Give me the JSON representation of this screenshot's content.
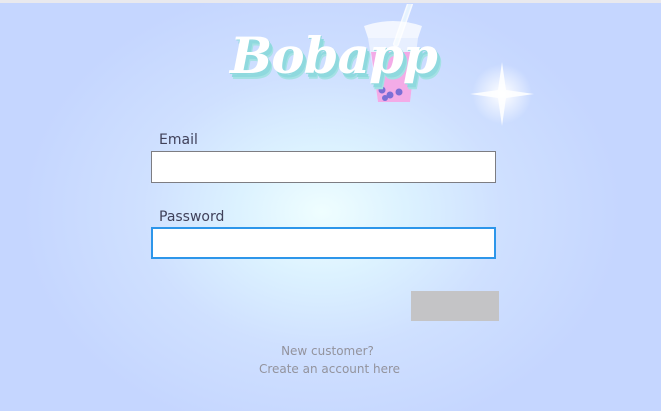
{
  "brand": {
    "name": "Bobapp",
    "icon": "bubble-tea-cup-icon",
    "colors": {
      "text": "#ffffff",
      "shadow": "#8fd9de",
      "tea": "#f3a7e6",
      "pearls": "#7a6fd6"
    }
  },
  "decor": {
    "sparkle_icon": "sparkle-icon"
  },
  "form": {
    "email_label": "Email",
    "email_value": "",
    "password_label": "Password",
    "password_value": "",
    "submit_label": ""
  },
  "signup": {
    "prompt": "New customer?",
    "link": "Create an account here"
  },
  "colors": {
    "background": "#c5d6ff",
    "glow": "#effeff",
    "focus_border": "#2d96ea",
    "button": "#c4c4c6"
  }
}
